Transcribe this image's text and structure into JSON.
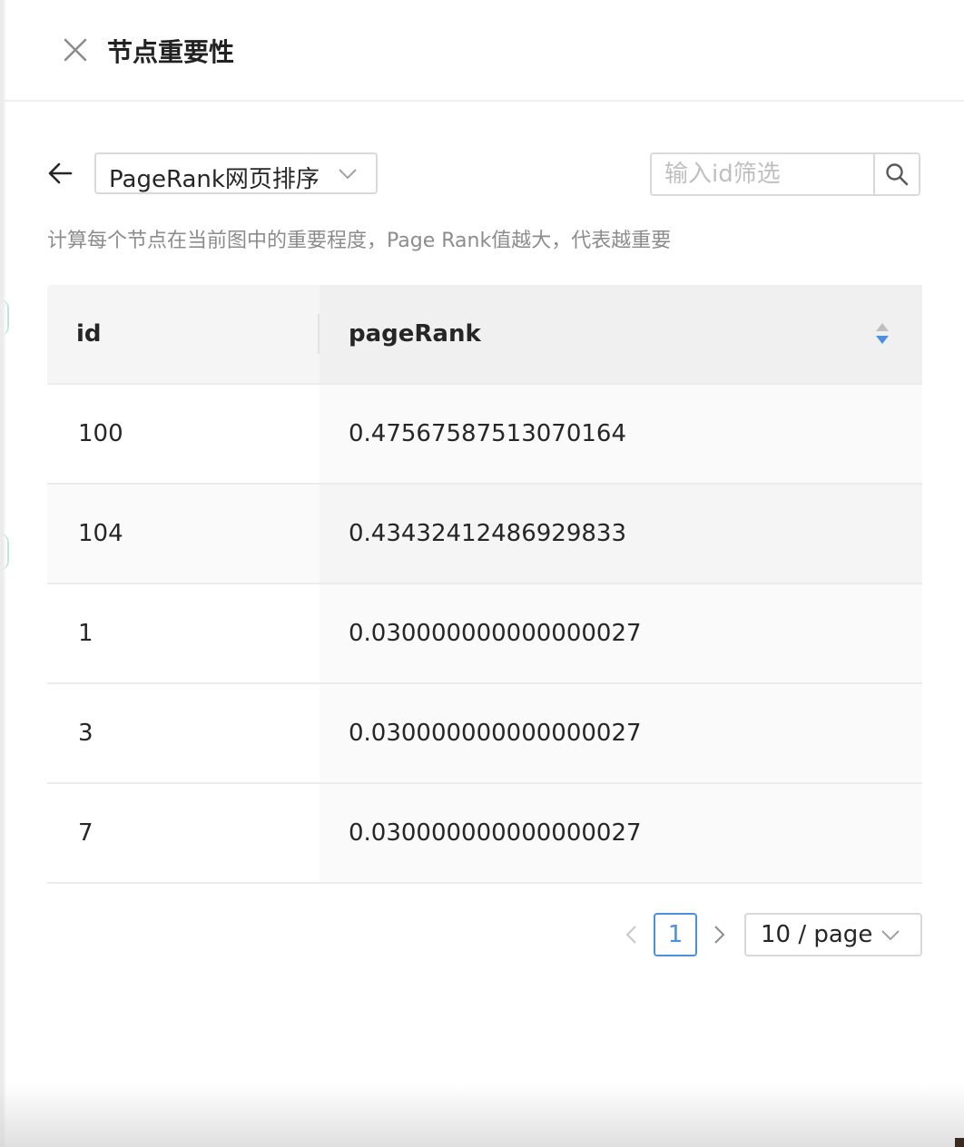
{
  "header": {
    "title": "节点重要性"
  },
  "toolbar": {
    "algorithm_selected": "PageRank网页排序",
    "search_placeholder": "输入id筛选",
    "search_value": ""
  },
  "description": "计算每个节点在当前图中的重要程度，Page Rank值越大，代表越重要",
  "table": {
    "columns": [
      "id",
      "pageRank"
    ],
    "rows": [
      {
        "id": "100",
        "pageRank": "0.47567587513070164"
      },
      {
        "id": "104",
        "pageRank": "0.43432412486929833"
      },
      {
        "id": "1",
        "pageRank": "0.030000000000000027"
      },
      {
        "id": "3",
        "pageRank": "0.030000000000000027"
      },
      {
        "id": "7",
        "pageRank": "0.030000000000000027"
      }
    ]
  },
  "pagination": {
    "current_page": "1",
    "page_size": "10 / page"
  },
  "colors": {
    "accent": "#4a90e2",
    "border": "#d9d9d9",
    "muted_text": "#8c8c8c"
  },
  "icons": [
    "close-icon",
    "arrow-left-icon",
    "chevron-down-icon",
    "search-icon",
    "sort-icon",
    "chevron-left-icon",
    "chevron-right-icon"
  ]
}
